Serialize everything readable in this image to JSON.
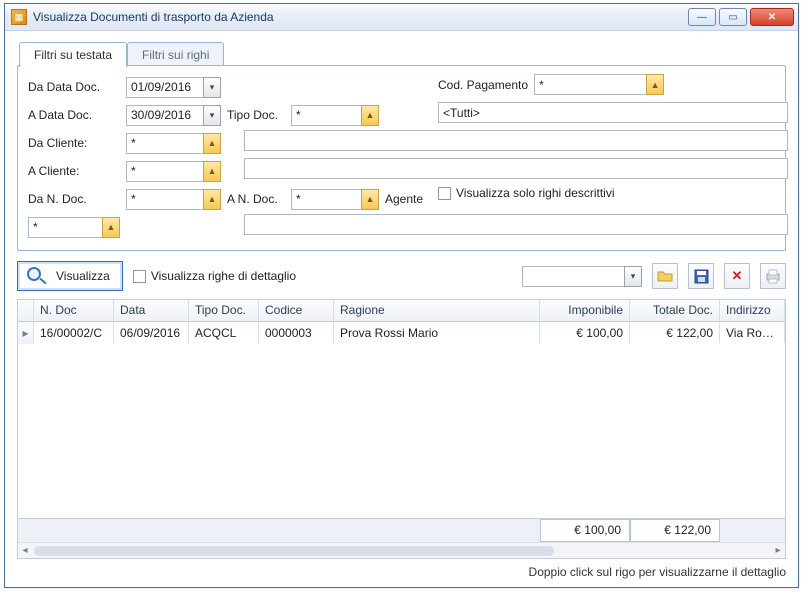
{
  "window": {
    "title": "Visualizza Documenti di trasporto da Azienda"
  },
  "tabs": {
    "active": "Filtri su testata",
    "inactive": "Filtri sui righi"
  },
  "filters": {
    "da_data_label": "Da Data Doc.",
    "a_data_label": "A Data Doc.",
    "da_cliente_label": "Da Cliente:",
    "a_cliente_label": "A Cliente:",
    "da_n_doc_label": "Da N. Doc.",
    "agente_label": "Agente",
    "tipo_doc_label": "Tipo Doc.",
    "a_n_doc_label": "A N. Doc.",
    "cod_pagamento_label": "Cod. Pagamento",
    "visualizza_descrittivi_label": "Visualizza solo righi descrittivi",
    "da_data_value": "01/09/2016",
    "a_data_value": "30/09/2016",
    "da_cliente_value": "*",
    "a_cliente_value": "*",
    "da_n_doc_value": "*",
    "agente_value": "*",
    "tipo_doc_value": "*",
    "tipo_doc_text": "<Tutti>",
    "a_n_doc_value": "*",
    "cod_pagamento_value": "*",
    "da_cliente_wide": "",
    "a_cliente_wide": "",
    "agente_wide": ""
  },
  "actions": {
    "visualizza_label": "Visualizza",
    "visualizza_dettaglio_label": "Visualizza righe di dettaglio",
    "combo_value": ""
  },
  "grid": {
    "headers": {
      "ndoc": "N. Doc",
      "data": "Data",
      "tipo": "Tipo Doc.",
      "codice": "Codice",
      "ragione": "Ragione",
      "imponibile": "Imponibile",
      "totale": "Totale Doc.",
      "indirizzo": "Indirizzo"
    },
    "rows": [
      {
        "ndoc": "16/00002/C",
        "data": "06/09/2016",
        "tipo": "ACQCL",
        "codice": "0000003",
        "ragione": "Prova Rossi Mario",
        "imponibile": "€ 100,00",
        "totale": "€ 122,00",
        "indirizzo": "Via Roma"
      }
    ],
    "sum": {
      "imponibile": "€ 100,00",
      "totale": "€ 122,00"
    }
  },
  "footer": {
    "hint": "Doppio click sul rigo per visualizzarne il dettaglio"
  }
}
